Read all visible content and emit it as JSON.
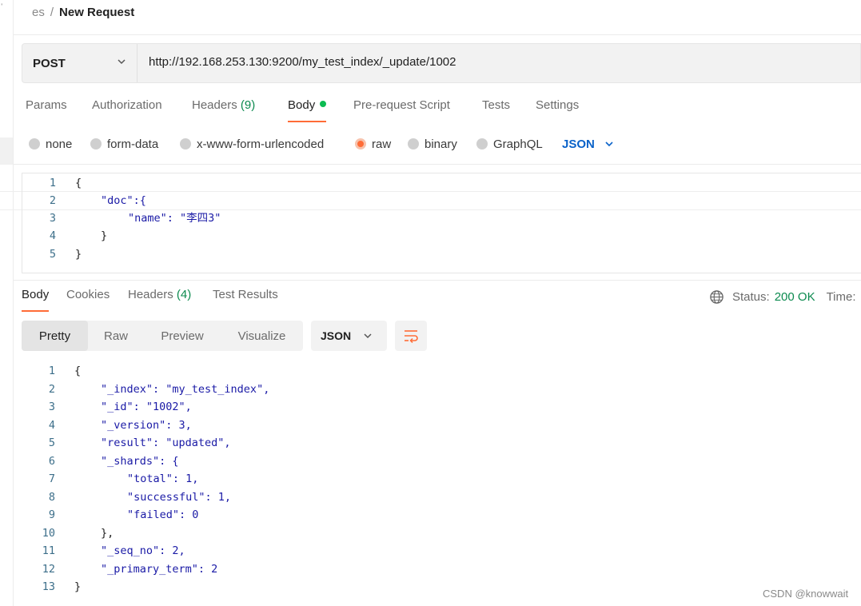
{
  "breadcrumb": {
    "parent": "es",
    "separator": "/",
    "current": "New Request"
  },
  "request": {
    "method": "POST",
    "url": "http://192.168.253.130:9200/my_test_index/_update/1002"
  },
  "request_tabs": {
    "params": "Params",
    "authorization": "Authorization",
    "headers": "Headers",
    "headers_count": "(9)",
    "body": "Body",
    "pre_request": "Pre-request Script",
    "tests": "Tests",
    "settings": "Settings",
    "active": "Body"
  },
  "body_options": {
    "none": "none",
    "form_data": "form-data",
    "urlencoded": "x-www-form-urlencoded",
    "raw": "raw",
    "binary": "binary",
    "graphql": "GraphQL",
    "selected": "raw",
    "format": "JSON"
  },
  "request_body_lines": [
    {
      "n": "1",
      "text": "{"
    },
    {
      "n": "2",
      "text": "\"doc\":{"
    },
    {
      "n": "3",
      "text": "\"name\": \"李四3\""
    },
    {
      "n": "4",
      "text": "}"
    },
    {
      "n": "5",
      "text": "}"
    }
  ],
  "response_tabs": {
    "body": "Body",
    "cookies": "Cookies",
    "headers": "Headers",
    "headers_count": "(4)",
    "test_results": "Test Results",
    "active": "Body"
  },
  "response_status": {
    "status_label": "Status:",
    "status_value": "200 OK",
    "time_label": "Time:"
  },
  "view_modes": {
    "pretty": "Pretty",
    "raw": "Raw",
    "preview": "Preview",
    "visualize": "Visualize",
    "active": "Pretty",
    "format": "JSON"
  },
  "response_body_lines": [
    {
      "n": "1",
      "text": "{"
    },
    {
      "n": "2",
      "text": "\"_index\": \"my_test_index\","
    },
    {
      "n": "3",
      "text": "\"_id\": \"1002\","
    },
    {
      "n": "4",
      "text": "\"_version\": 3,"
    },
    {
      "n": "5",
      "text": "\"result\": \"updated\","
    },
    {
      "n": "6",
      "text": "\"_shards\": {"
    },
    {
      "n": "7",
      "text": "\"total\": 1,"
    },
    {
      "n": "8",
      "text": "\"successful\": 1,"
    },
    {
      "n": "9",
      "text": "\"failed\": 0"
    },
    {
      "n": "10",
      "text": "},"
    },
    {
      "n": "11",
      "text": "\"_seq_no\": 2,"
    },
    {
      "n": "12",
      "text": "\"_primary_term\": 2"
    },
    {
      "n": "13",
      "text": "}"
    }
  ],
  "watermark": "CSDN @knowwait",
  "colors": {
    "accent": "#ff6c37",
    "success": "#0c8a4f",
    "link_blue": "#0a62c9"
  }
}
